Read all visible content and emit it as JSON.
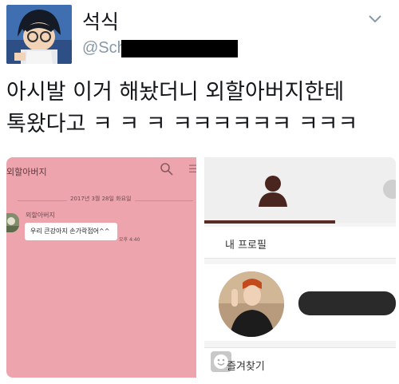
{
  "tweet": {
    "display_name": "석식",
    "handle_visible": "@Sch",
    "text": "아시발 이거 해놨더니 외할아버지한테\n톡왔다고 ㅋ ㅋ ㅋ ㅋㅋㅋㅋㅋㅋ ㅋㅋㅋ",
    "menu_icon": "chevron-down-icon"
  },
  "chat_screenshot": {
    "title": "외할아버지",
    "date": "2017년 3월 28일 화요일",
    "sender": "외할아버지",
    "message": "우리 큰강아지 손가락접어^^",
    "time": "오후 4:40",
    "menu_glyph": "☰"
  },
  "profile_screenshot": {
    "my_profile_label": "내 프로필",
    "favorites_label": "즐겨찾기"
  },
  "colors": {
    "chat_bg": "#eda4ad",
    "tab_underline": "#5a2a24",
    "handle_gray": "#8899a6"
  }
}
